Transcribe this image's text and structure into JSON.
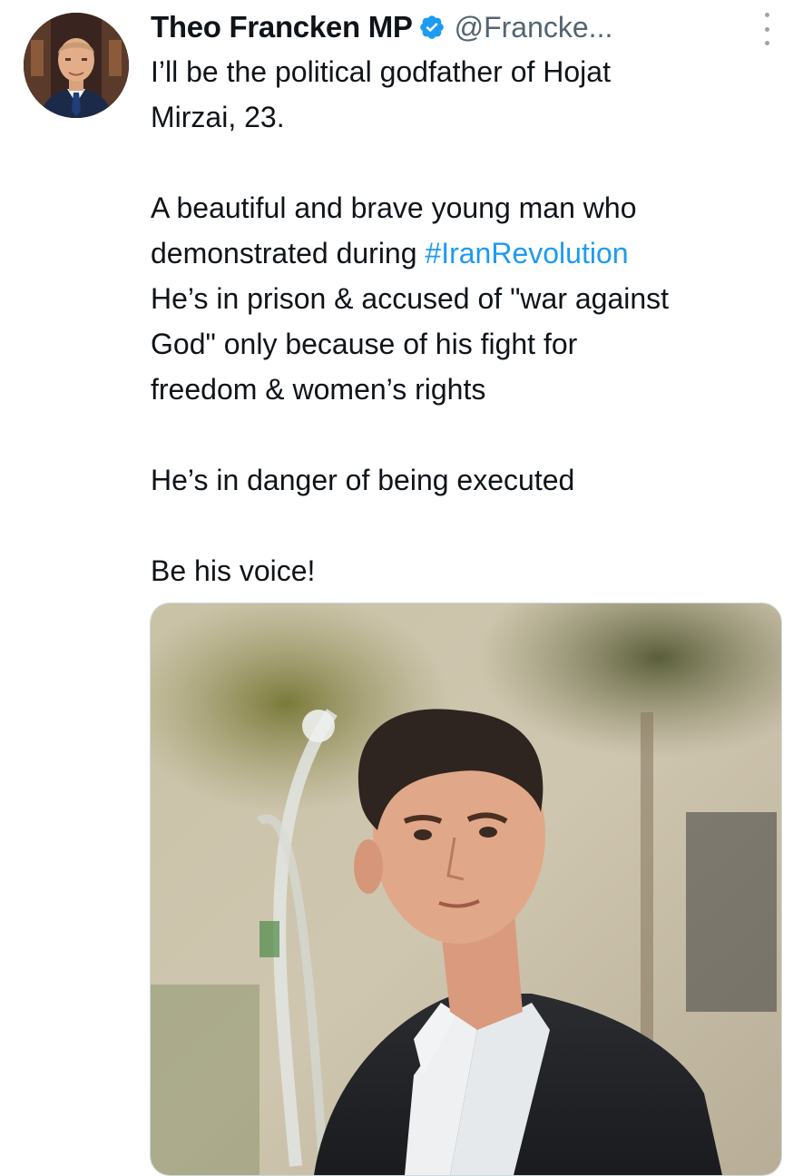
{
  "author": {
    "display_name": "Theo Francken MP",
    "verified": true,
    "verified_icon": "verified-badge-icon",
    "handle": "@Francke...",
    "accent_color": "#1d9bf0"
  },
  "tweet": {
    "line1": "I’ll be the political godfather of Hojat",
    "line2": "Mirzai, 23.",
    "line3": "A beautiful and brave young man who",
    "line4_prefix": "demonstrated during ",
    "hashtag": "#IranRevolution",
    "line5": "He’s in prison & accused of \"war against",
    "line6": "God\" only because of his fight for",
    "line7": "freedom & women’s rights",
    "line8": "He’s in danger of being executed",
    "line9": "Be his voice!"
  },
  "menu": {
    "icon": "more-options-icon"
  },
  "media": {
    "kind": "photo"
  }
}
